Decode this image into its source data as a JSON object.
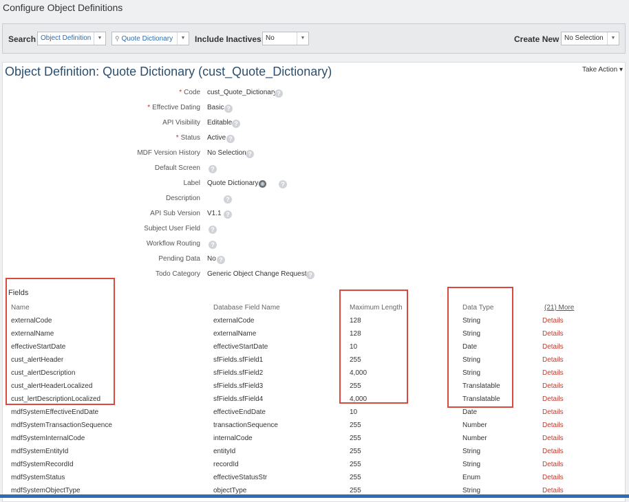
{
  "page": {
    "title": "Configure Object Definitions"
  },
  "search_bar": {
    "search_label": "Search",
    "search_type": "Object Definition",
    "search_value": "Quote Dictionary",
    "include_inactives_label": "Include Inactives:",
    "include_inactives_value": "No",
    "create_new_label": "Create New",
    "create_new_value": "No Selection"
  },
  "object": {
    "title": "Object Definition: Quote Dictionary (cust_Quote_Dictionary)",
    "take_action": "Take Action"
  },
  "properties": [
    {
      "label": "Code",
      "required": "*",
      "value": "cust_Quote_Dictionary"
    },
    {
      "label": "Effective Dating",
      "required": "*",
      "value": "Basic"
    },
    {
      "label": "API Visibility",
      "required": "",
      "value": "Editable"
    },
    {
      "label": "Status",
      "required": "*",
      "value": "Active"
    },
    {
      "label": "MDF Version History",
      "required": "",
      "value": "No Selection"
    },
    {
      "label": "Default Screen",
      "required": "",
      "value": ""
    },
    {
      "label": "Label",
      "required": "",
      "value": "Quote Dictionary"
    },
    {
      "label": "Description",
      "required": "",
      "value": ""
    },
    {
      "label": "API Sub Version",
      "required": "",
      "value": "V1.1"
    },
    {
      "label": "Subject User Field",
      "required": "",
      "value": ""
    },
    {
      "label": "Workflow Routing",
      "required": "",
      "value": ""
    },
    {
      "label": "Pending Data",
      "required": "",
      "value": "No"
    },
    {
      "label": "Todo Category",
      "required": "",
      "value": "Generic Object Change Requests"
    }
  ],
  "fields": {
    "title": "Fields",
    "columns": [
      "Name",
      "Database Field Name",
      "Maximum Length",
      "Data Type"
    ],
    "more": "(21) More",
    "details_label": "Details",
    "rows": [
      [
        "externalCode",
        "externalCode",
        "128",
        "String"
      ],
      [
        "externalName",
        "externalName",
        "128",
        "String"
      ],
      [
        "effectiveStartDate",
        "effectiveStartDate",
        "10",
        "Date"
      ],
      [
        "cust_alertHeader",
        "sfFields.sfField1",
        "255",
        "String"
      ],
      [
        "cust_alertDescription",
        "sfFields.sfField2",
        "4,000",
        "String"
      ],
      [
        "cust_alertHeaderLocalized",
        "sfFields.sfField3",
        "255",
        "Translatable"
      ],
      [
        "cust_lertDescriptionLocalized",
        "sfFields.sfField4",
        "4,000",
        "Translatable"
      ],
      [
        "mdfSystemEffectiveEndDate",
        "effectiveEndDate",
        "10",
        "Date"
      ],
      [
        "mdfSystemTransactionSequence",
        "transactionSequence",
        "255",
        "Number"
      ],
      [
        "mdfSystemInternalCode",
        "internalCode",
        "255",
        "Number"
      ],
      [
        "mdfSystemEntityId",
        "entityId",
        "255",
        "String"
      ],
      [
        "mdfSystemRecordId",
        "recordId",
        "255",
        "String"
      ],
      [
        "mdfSystemStatus",
        "effectiveStatusStr",
        "255",
        "Enum"
      ],
      [
        "mdfSystemObjectType",
        "objectType",
        "255",
        "String"
      ]
    ]
  },
  "colors": {
    "highlight": "#d9473d",
    "link": "#c0392b",
    "title": "#2b4f6e",
    "required": "#d22"
  }
}
